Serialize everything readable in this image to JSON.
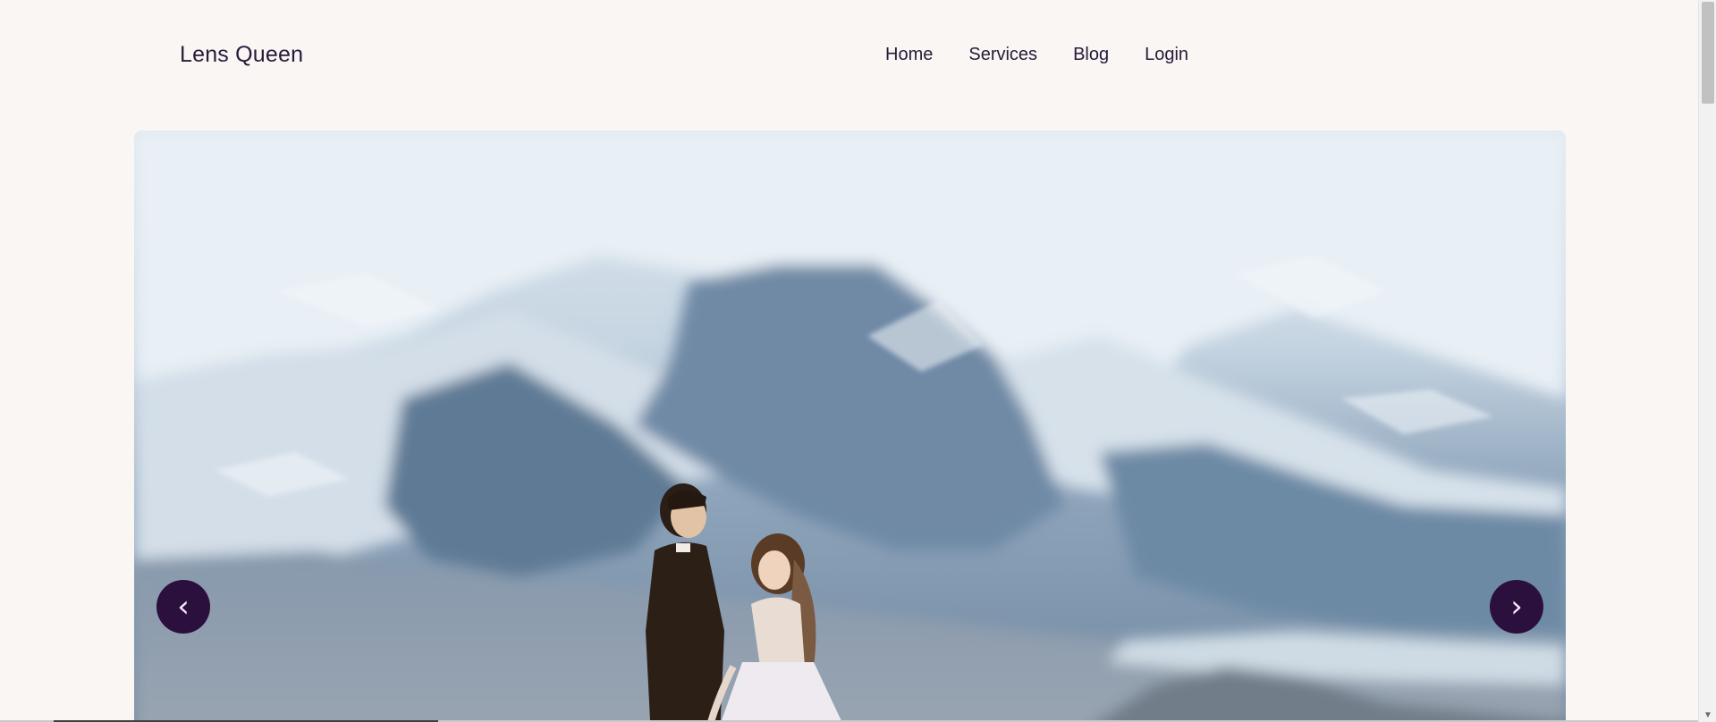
{
  "brand": {
    "name": "Lens Queen"
  },
  "nav": {
    "items": [
      {
        "label": "Home"
      },
      {
        "label": "Services"
      },
      {
        "label": "Blog"
      },
      {
        "label": "Login"
      }
    ]
  },
  "carousel": {
    "prev_label": "‹",
    "next_label": "›",
    "slide_alt": "couple standing before snowy mountains"
  },
  "colors": {
    "background": "#f9f6f3",
    "text": "#2a1a3a",
    "button": "#2b0f3d",
    "button_text": "#f2e9ff",
    "sky_blue": "#7791ad"
  }
}
